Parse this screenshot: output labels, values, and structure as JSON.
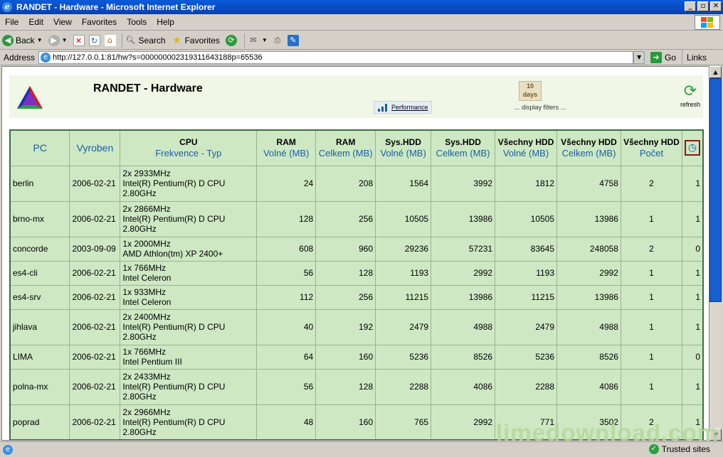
{
  "window": {
    "title": "RANDET - Hardware - Microsoft Internet Explorer"
  },
  "menu": [
    "File",
    "Edit",
    "View",
    "Favorites",
    "Tools",
    "Help"
  ],
  "toolbar": {
    "back": "Back",
    "search": "Search",
    "favorites": "Favorites"
  },
  "address": {
    "label": "Address",
    "url": "http://127.0.0.1:81/hw?s=000000002319311643188p=65536",
    "go": "Go",
    "links": "Links"
  },
  "page": {
    "title": "RANDET - Hardware",
    "performance_label": "Performance",
    "days_label": "10\ndays",
    "filters_label": "... display filters ...",
    "refresh_label": "refresh"
  },
  "table": {
    "headers": [
      {
        "top": "",
        "sub": "PC"
      },
      {
        "top": "",
        "sub": "Vyroben"
      },
      {
        "top": "CPU",
        "sub": "Frekvence - Typ"
      },
      {
        "top": "RAM",
        "sub": "Volné (MB)"
      },
      {
        "top": "RAM",
        "sub": "Celkem (MB)"
      },
      {
        "top": "Sys.HDD",
        "sub": "Volné (MB)"
      },
      {
        "top": "Sys.HDD",
        "sub": "Celkem (MB)"
      },
      {
        "top": "Všechny HDD",
        "sub": "Volné (MB)"
      },
      {
        "top": "Všechny HDD",
        "sub": "Celkem (MB)"
      },
      {
        "top": "Všechny HDD",
        "sub": "Počet"
      }
    ],
    "rows": [
      {
        "pc": "berlin",
        "date": "2006-02-21",
        "cpu": [
          "2x 2933MHz",
          "Intel(R) Pentium(R) D CPU",
          "2.80GHz"
        ],
        "ram_free": "24",
        "ram_total": "208",
        "sys_free": "1564",
        "sys_total": "3992",
        "all_free": "1812",
        "all_total": "4758",
        "count": "2",
        "last": "1"
      },
      {
        "pc": "brno-mx",
        "date": "2006-02-21",
        "cpu": [
          "2x 2866MHz",
          "Intel(R) Pentium(R) D CPU",
          "2.80GHz"
        ],
        "ram_free": "128",
        "ram_total": "256",
        "sys_free": "10505",
        "sys_total": "13986",
        "all_free": "10505",
        "all_total": "13986",
        "count": "1",
        "last": "1"
      },
      {
        "pc": "concorde",
        "date": "2003-09-09",
        "cpu": [
          "1x 2000MHz",
          "AMD Athlon(tm) XP 2400+"
        ],
        "ram_free": "608",
        "ram_total": "960",
        "sys_free": "29236",
        "sys_total": "57231",
        "all_free": "83645",
        "all_total": "248058",
        "count": "2",
        "last": "0"
      },
      {
        "pc": "es4-cli",
        "date": "2006-02-21",
        "cpu": [
          "1x 766MHz",
          "Intel Celeron"
        ],
        "ram_free": "56",
        "ram_total": "128",
        "sys_free": "1193",
        "sys_total": "2992",
        "all_free": "1193",
        "all_total": "2992",
        "count": "1",
        "last": "1"
      },
      {
        "pc": "es4-srv",
        "date": "2006-02-21",
        "cpu": [
          "1x 933MHz",
          "Intel Celeron"
        ],
        "ram_free": "112",
        "ram_total": "256",
        "sys_free": "11215",
        "sys_total": "13986",
        "all_free": "11215",
        "all_total": "13986",
        "count": "1",
        "last": "1"
      },
      {
        "pc": "jihlava",
        "date": "2006-02-21",
        "cpu": [
          "2x 2400MHz",
          "Intel(R) Pentium(R) D CPU",
          "2.80GHz"
        ],
        "ram_free": "40",
        "ram_total": "192",
        "sys_free": "2479",
        "sys_total": "4988",
        "all_free": "2479",
        "all_total": "4988",
        "count": "1",
        "last": "1"
      },
      {
        "pc": "LIMA",
        "date": "2006-02-21",
        "cpu": [
          "1x 766MHz",
          "Intel Pentium III"
        ],
        "ram_free": "64",
        "ram_total": "160",
        "sys_free": "5236",
        "sys_total": "8526",
        "all_free": "5236",
        "all_total": "8526",
        "count": "1",
        "last": "0"
      },
      {
        "pc": "polna-mx",
        "date": "2006-02-21",
        "cpu": [
          "2x 2433MHz",
          "Intel(R) Pentium(R) D CPU",
          "2.80GHz"
        ],
        "ram_free": "56",
        "ram_total": "128",
        "sys_free": "2288",
        "sys_total": "4086",
        "all_free": "2288",
        "all_total": "4086",
        "count": "1",
        "last": "1"
      },
      {
        "pc": "poprad",
        "date": "2006-02-21",
        "cpu": [
          "2x 2966MHz",
          "Intel(R) Pentium(R) D CPU",
          "2.80GHz"
        ],
        "ram_free": "48",
        "ram_total": "160",
        "sys_free": "765",
        "sys_total": "2992",
        "all_free": "771",
        "all_total": "3502",
        "count": "2",
        "last": "1"
      }
    ]
  },
  "status": {
    "zone": "Trusted sites"
  },
  "watermark": "limedownload.com",
  "colors": {
    "title_bar": "#0a5bd8",
    "table_bg": "#cde8c3",
    "header_bg": "#f0f7e6",
    "link_blue": "#1a5ea4"
  }
}
